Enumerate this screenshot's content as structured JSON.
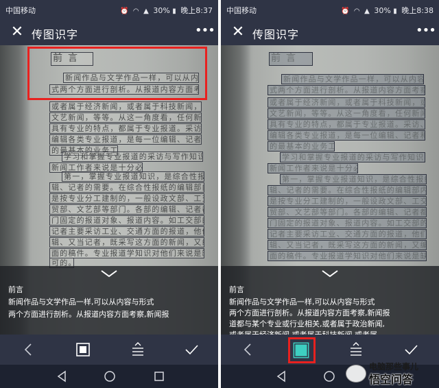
{
  "status_left": {
    "carrier": "中国移动",
    "battery": "30%",
    "time": "晚上8:37"
  },
  "status_right": {
    "carrier": "中国移动",
    "battery": "30%",
    "time": "晚上8:38"
  },
  "app": {
    "title": "传图识字"
  },
  "icons": {
    "close": "close-icon",
    "more": "more-dots-icon",
    "back": "chevron-left-icon",
    "crop": "crop-frame-icon",
    "adjust": "adjust-lines-icon",
    "confirm": "checkmark-icon",
    "nav_back": "triangle-back-icon",
    "nav_home": "circle-home-icon",
    "nav_recent": "square-recent-icon"
  },
  "document_lines": [
    "前言",
    "新闻作品与文学作品一样，可以从内容与形",
    "式两个方面进行剖析。从报道内容方面考察，",
    "或者属于经济新闻，或者属于科技新闻，或者属于",
    "文艺新闻，等等。从这一角度看，任何新闻报道都",
    "具有专业的特点，都属于专业报道。采访、写作、",
    "编辑各类专业报道，是每一位编辑、记者和通讯员",
    "的最基本的业务工作。",
    "学习和掌握专业报道的采访与写作知识，对于",
    "新闻工作者来说是十分必要的。",
    "第一，掌握专业报道知识，是综合性报纸的编",
    "辑、记者的需要。在综合性报纸的编辑部内，大多",
    "是按专业分工建制的，一般设政文部、工交部、财",
    "贸部、文艺部等部门。各部的编辑、记者都有本部",
    "门固定的报道对象、报道内容。如工交部的编辑、",
    "记者主要采访工业、交通方面的报道，他们既当编",
    "辑、又当记者，既采写这方面的新闻，又编发这方",
    "面的稿件。专业报道学知识对他们来说是缺一不",
    "可的。",
    "第二，掌握专业报道知识，也是专业报纸",
    "编辑、记者的需要。专业报纸是由"
  ],
  "result_left": {
    "lines": [
      "前言",
      "新闻作品与文学作品一样,可以从内容与形式",
      "两个方面进行剖析。从报道内容方面考察,新闻报"
    ]
  },
  "result_right": {
    "lines": [
      "前言",
      "新闻作品与文学作品一样,可以从内容与形式",
      "两个方面进行剖析。从报道内容方面考察,新闻报",
      "道都与某个专业或行业相关,或者属于政治新闻,",
      "或者属于经济新闻,或者属于科技新闻,或者属"
    ]
  },
  "watermark": {
    "top": "电脑那些事儿",
    "main": "悟空问答"
  },
  "colors": {
    "highlight": "#e8211f",
    "crop_active": "#3ecfc1",
    "bar": "#2f3445"
  }
}
